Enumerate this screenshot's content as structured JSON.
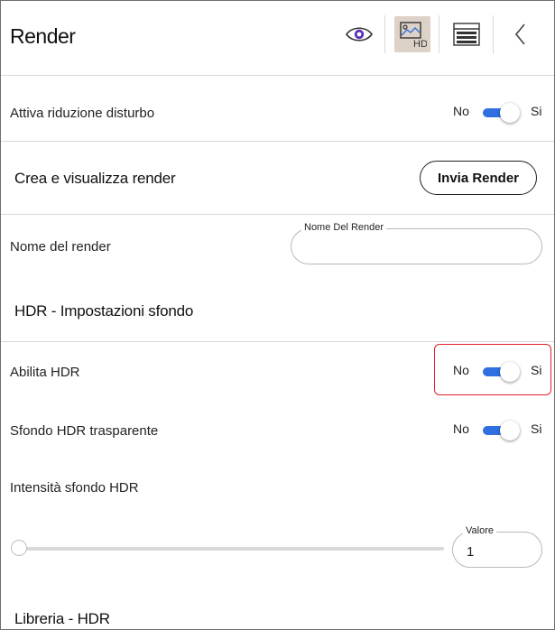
{
  "header": {
    "title": "Render",
    "icons": [
      "eye-icon",
      "hd-image-icon",
      "list-panel-icon",
      "chevron-left-icon"
    ]
  },
  "denoise": {
    "label": "Attiva riduzione disturbo",
    "no": "No",
    "si": "Si",
    "value": "Si"
  },
  "create": {
    "heading": "Crea e visualizza render",
    "button": "Invia Render"
  },
  "render_name": {
    "label": "Nome del render",
    "legend": "Nome Del Render",
    "value": ""
  },
  "hdr": {
    "heading": "HDR - Impostazioni sfondo",
    "enable": {
      "label": "Abilita HDR",
      "no": "No",
      "si": "Si",
      "value": "Si"
    },
    "transparent": {
      "label": "Sfondo HDR trasparente",
      "no": "No",
      "si": "Si",
      "value": "Si"
    },
    "intensity": {
      "label": "Intensità sfondo HDR",
      "legend": "Valore",
      "value": "1",
      "slider_fraction": 0
    }
  },
  "library": {
    "heading": "Libreria - HDR"
  },
  "colors": {
    "accent": "#2f6fe0",
    "highlight": "#e0202a",
    "active_tab": "#ddd2c7"
  }
}
